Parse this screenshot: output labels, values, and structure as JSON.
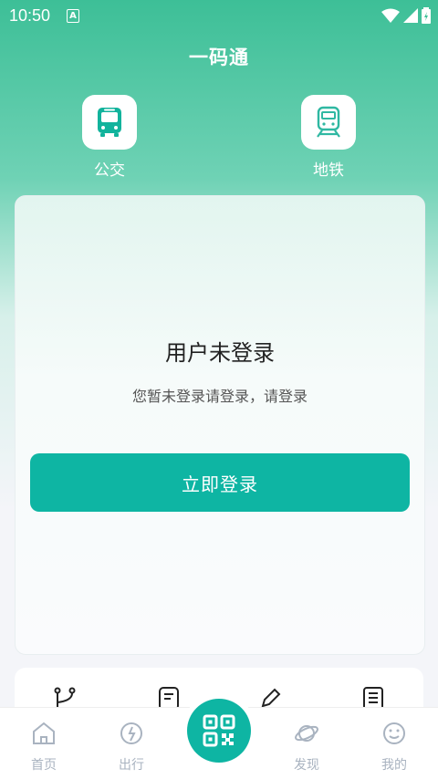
{
  "status_bar": {
    "time": "10:50",
    "notification_badge": "A"
  },
  "header": {
    "title": "一码通"
  },
  "transit_modes": [
    {
      "label": "公交",
      "icon": "bus-icon"
    },
    {
      "label": "地铁",
      "icon": "metro-icon"
    }
  ],
  "login_card": {
    "heading": "用户未登录",
    "message": "您暂未登录请登录，请登录",
    "button_label": "立即登录"
  },
  "shortcuts": [
    {
      "icon": "route-icon"
    },
    {
      "icon": "note-icon"
    },
    {
      "icon": "edit-icon"
    },
    {
      "icon": "document-icon"
    }
  ],
  "tab_bar": {
    "tabs": [
      {
        "label": "首页",
        "icon": "home-icon"
      },
      {
        "label": "出行",
        "icon": "travel-icon"
      },
      {
        "label": "发现",
        "icon": "planet-icon"
      },
      {
        "label": "我的",
        "icon": "smile-icon"
      }
    ],
    "center_button_icon": "qr-code-icon"
  },
  "colors": {
    "brand": "#0eb5a3",
    "header_gradient_top": "#3dbf97",
    "tab_inactive": "#a9b3c0"
  }
}
